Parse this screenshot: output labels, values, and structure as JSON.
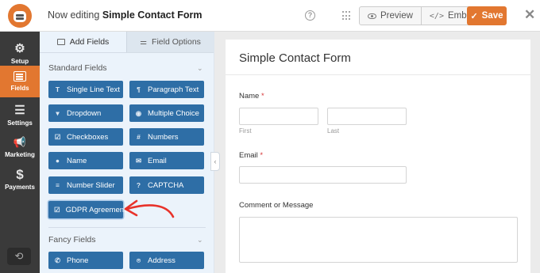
{
  "header": {
    "editing_prefix": "Now editing",
    "form_name": "Simple Contact Form",
    "help_glyph": "?",
    "preview_label": "Preview",
    "embed_label": "Embed",
    "save_label": "Save",
    "close_glyph": "✕",
    "brand_color": "#e27730"
  },
  "leftnav": {
    "items": [
      {
        "label": "Setup",
        "icon": "gear-icon",
        "glyph": "⚙"
      },
      {
        "label": "Fields",
        "icon": "fields-icon",
        "glyph": ""
      },
      {
        "label": "Settings",
        "icon": "sliders-icon",
        "glyph": "☰"
      },
      {
        "label": "Marketing",
        "icon": "megaphone-icon",
        "glyph": "📢"
      },
      {
        "label": "Payments",
        "icon": "dollar-icon",
        "glyph": "$"
      }
    ],
    "history_glyph": "⟲"
  },
  "panel": {
    "tabs": [
      {
        "label": "Add Fields"
      },
      {
        "label": "Field Options"
      }
    ],
    "standard_title": "Standard Fields",
    "fancy_title": "Fancy Fields",
    "standard_fields": [
      {
        "label": "Single Line Text",
        "icon": "text-icon",
        "glyph": "T"
      },
      {
        "label": "Paragraph Text",
        "icon": "paragraph-icon",
        "glyph": "¶"
      },
      {
        "label": "Dropdown",
        "icon": "dropdown-icon",
        "glyph": "▾"
      },
      {
        "label": "Multiple Choice",
        "icon": "radio-icon",
        "glyph": "◉"
      },
      {
        "label": "Checkboxes",
        "icon": "checkbox-icon",
        "glyph": "☑"
      },
      {
        "label": "Numbers",
        "icon": "hash-icon",
        "glyph": "#"
      },
      {
        "label": "Name",
        "icon": "user-icon",
        "glyph": "●"
      },
      {
        "label": "Email",
        "icon": "envelope-icon",
        "glyph": "✉"
      },
      {
        "label": "Number Slider",
        "icon": "slider-icon",
        "glyph": "≡"
      },
      {
        "label": "CAPTCHA",
        "icon": "question-icon",
        "glyph": "?"
      },
      {
        "label": "GDPR Agreement",
        "icon": "checkbox-icon",
        "glyph": "☑"
      }
    ],
    "fancy_fields": [
      {
        "label": "Phone",
        "icon": "phone-icon",
        "glyph": "✆"
      },
      {
        "label": "Address",
        "icon": "map-pin-icon",
        "glyph": "⌾"
      }
    ]
  },
  "form": {
    "title": "Simple Contact Form",
    "name_label": "Name",
    "first_sublabel": "First",
    "last_sublabel": "Last",
    "email_label": "Email",
    "comment_label": "Comment or Message",
    "required_mark": "*"
  }
}
